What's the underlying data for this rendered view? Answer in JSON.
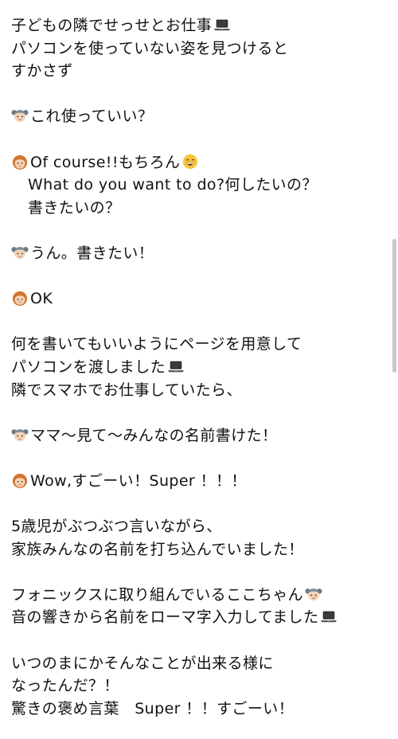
{
  "post": {
    "lines": [
      {
        "text": "子どもの隣でせっせとお仕事",
        "icon_after": "laptop-icon"
      },
      {
        "text": "パソコンを使っていない姿を見つけると"
      },
      {
        "text": "すかさず"
      },
      {
        "text": ""
      },
      {
        "text": "これ使っていい？",
        "icon_before": "child-face-icon"
      },
      {
        "text": ""
      },
      {
        "text": "Of course!!もちろん",
        "icon_before": "mother-face-icon",
        "icon_after": "grinning-face-icon"
      },
      {
        "text": "What do you want to do?何したいの？",
        "indent": true
      },
      {
        "text": "書きたいの？",
        "indent": true
      },
      {
        "text": ""
      },
      {
        "text": "うん。書きたい！",
        "icon_before": "child-face-icon"
      },
      {
        "text": ""
      },
      {
        "text": "OK",
        "icon_before": "mother-face-icon"
      },
      {
        "text": ""
      },
      {
        "text": "何を書いてもいいようにページを用意して"
      },
      {
        "text": "パソコンを渡しました",
        "icon_after": "laptop-icon"
      },
      {
        "text": "隣でスマホでお仕事していたら、"
      },
      {
        "text": ""
      },
      {
        "text": "ママ〜見て〜みんなの名前書けた！",
        "icon_before": "child-face-icon"
      },
      {
        "text": ""
      },
      {
        "text": "Wow,すごーい！Super ！！！",
        "icon_before": "mother-face-icon"
      },
      {
        "text": ""
      },
      {
        "text": "5歳児がぶつぶつ言いながら、"
      },
      {
        "text": "家族みんなの名前を打ち込んでいました！"
      },
      {
        "text": ""
      },
      {
        "text": "フォニックスに取り組んでいるここちゃん",
        "icon_after": "child-face-icon"
      },
      {
        "text": "音の響きから名前をローマ字入力してました",
        "icon_after": "laptop-icon"
      },
      {
        "text": ""
      },
      {
        "text": "いつのまにかそんなことが出来る様に"
      },
      {
        "text": "なったんだ？！"
      },
      {
        "text": "驚きの褒め言葉　Super ！！すごーい！"
      }
    ]
  }
}
